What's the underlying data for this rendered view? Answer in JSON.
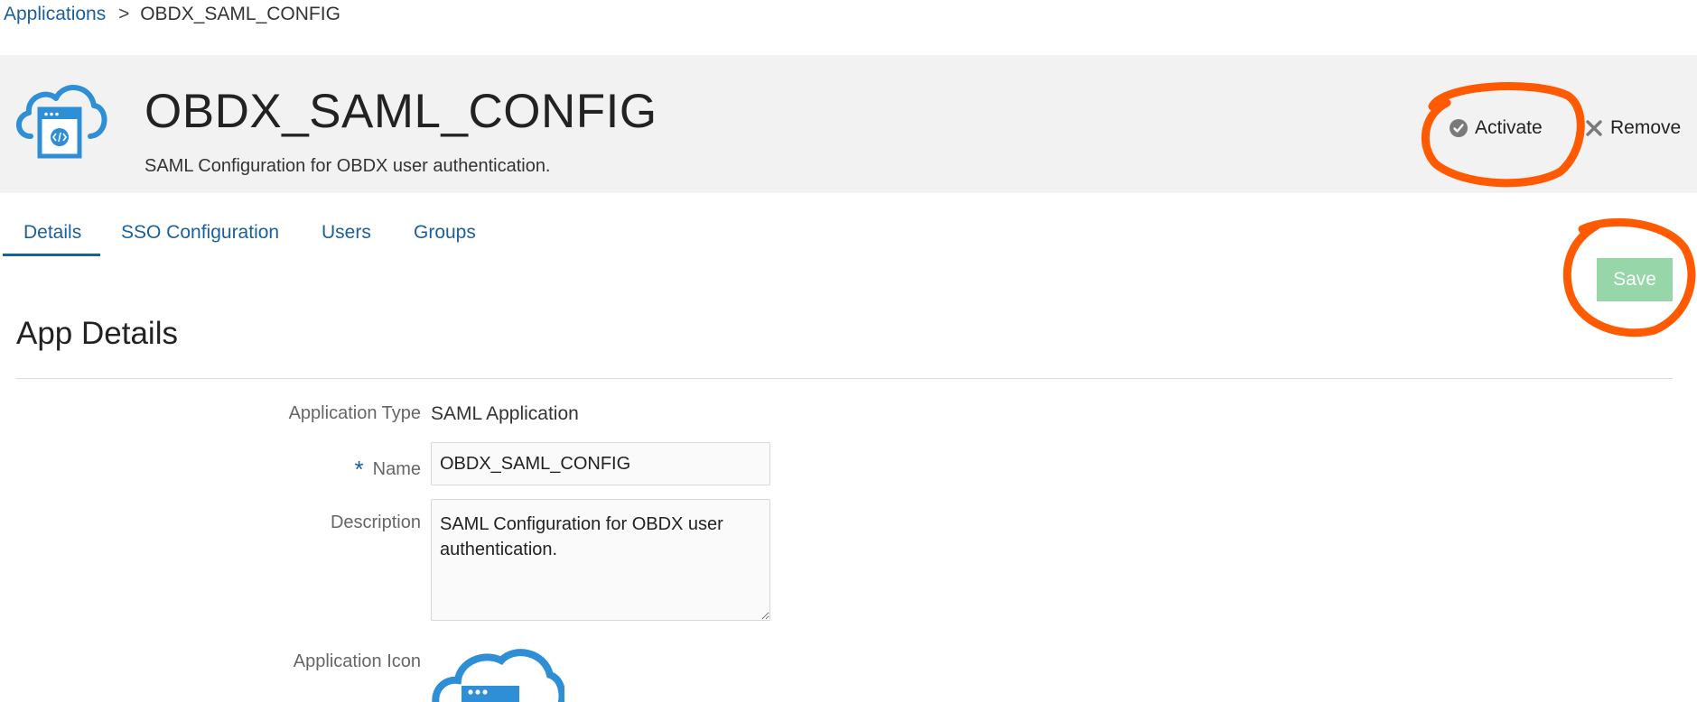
{
  "breadcrumb": {
    "parent": "Applications",
    "separator": ">",
    "current": "OBDX_SAML_CONFIG"
  },
  "header": {
    "title": "OBDX_SAML_CONFIG",
    "subtitle": "SAML Configuration for OBDX user authentication.",
    "icon": "cloud-app-icon",
    "actions": {
      "activate_label": "Activate",
      "remove_label": "Remove"
    }
  },
  "tabs": [
    {
      "label": "Details",
      "active": true
    },
    {
      "label": "SSO Configuration",
      "active": false
    },
    {
      "label": "Users",
      "active": false
    },
    {
      "label": "Groups",
      "active": false
    }
  ],
  "save_label": "Save",
  "section": {
    "title": "App Details"
  },
  "form": {
    "application_type": {
      "label": "Application Type",
      "value": "SAML Application"
    },
    "name": {
      "label": "Name",
      "required_marker": "*",
      "value": "OBDX_SAML_CONFIG"
    },
    "description": {
      "label": "Description",
      "value": "SAML Configuration for OBDX user authentication."
    },
    "application_icon": {
      "label": "Application Icon",
      "icon": "cloud-app-icon"
    }
  },
  "colors": {
    "link": "#1a5f9e",
    "header_bg": "#f2f2f2",
    "save_button": "#96d6a8",
    "annotation": "#ff5a00",
    "icon_blue": "#2e8fd6"
  }
}
